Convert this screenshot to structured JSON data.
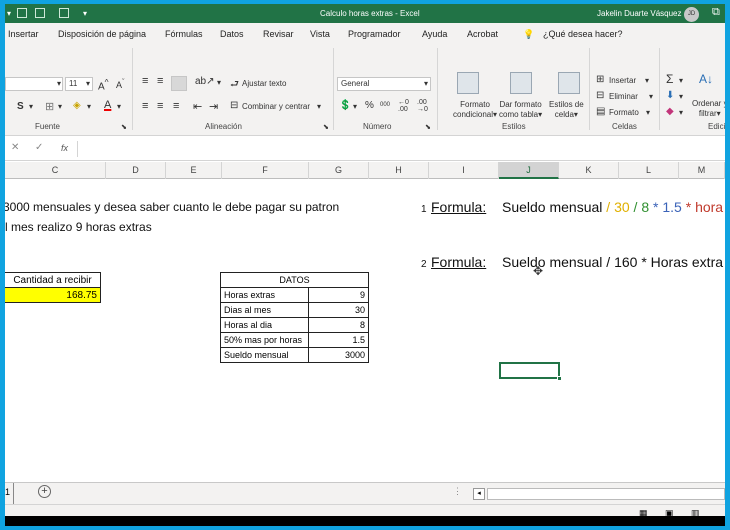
{
  "window": {
    "title": "Calculo horas extras  -  Excel",
    "user": "Jakelin Duarte Vásquez",
    "user_initials": "JD"
  },
  "menu": {
    "tabs": [
      "Insertar",
      "Disposición de página",
      "Fórmulas",
      "Datos",
      "Revisar",
      "Vista",
      "Programador",
      "Ayuda",
      "Acrobat"
    ],
    "search": "¿Qué desea hacer?"
  },
  "ribbon": {
    "font_size": "11",
    "wrap_text": "Ajustar texto",
    "merge_center": "Combinar y centrar",
    "number_format": "General",
    "percent": "%",
    "thousands": "000",
    "cond_format": [
      "Formato",
      "condicional"
    ],
    "table_format": [
      "Dar formato",
      "como tabla"
    ],
    "cell_styles": [
      "Estilos de",
      "celda"
    ],
    "insert": "Insertar",
    "delete": "Eliminar",
    "format": "Formato",
    "sort": [
      "Ordenar y",
      "filtrar"
    ],
    "groups": {
      "font": "Fuente",
      "alignment": "Alineación",
      "number": "Número",
      "styles": "Estilos",
      "cells": "Celdas",
      "editing": "Edici"
    }
  },
  "formula_bar": {
    "fx": "fx",
    "value": ""
  },
  "columns": [
    "C",
    "D",
    "E",
    "F",
    "G",
    "H",
    "I",
    "J",
    "K",
    "L",
    "M"
  ],
  "selected_column": "J",
  "sheet": {
    "problem_line1": "3000 mensuales y desea saber cuanto le debe pagar su patron",
    "problem_line2": "l mes realizo 9 horas extras",
    "result_header": "Cantidad a recibir",
    "result_value": "168.75",
    "datos_title": "DATOS",
    "datos": [
      {
        "label": "Horas extras",
        "value": "9"
      },
      {
        "label": "Dias al mes",
        "value": "30"
      },
      {
        "label": "Horas al dia",
        "value": "8"
      },
      {
        "label": "50% mas por horas",
        "value": "1.5"
      },
      {
        "label": "Sueldo mensual",
        "value": "3000"
      }
    ],
    "formula1": {
      "num": "1",
      "label": "Formula:",
      "parts": [
        {
          "text": "Sueldo mensual",
          "color": "#111111"
        },
        {
          "text": " / ",
          "color": "#e0b000"
        },
        {
          "text": "30",
          "color": "#e0b000"
        },
        {
          "text": " / ",
          "color": "#2f8f2f"
        },
        {
          "text": "8",
          "color": "#2f8f2f"
        },
        {
          "text": " * ",
          "color": "#3b63b8"
        },
        {
          "text": "1.5",
          "color": "#3b63b8"
        },
        {
          "text": " * ",
          "color": "#c0392b"
        },
        {
          "text": "hora",
          "color": "#c0392b"
        }
      ]
    },
    "formula2": {
      "num": "2",
      "label": "Formula:",
      "text": "Sueldo mensual / 160 * Horas extra"
    }
  },
  "sheet_tab_number": "1",
  "colors": {
    "excel_green": "#217346",
    "highlight_yellow": "#ffff00"
  }
}
